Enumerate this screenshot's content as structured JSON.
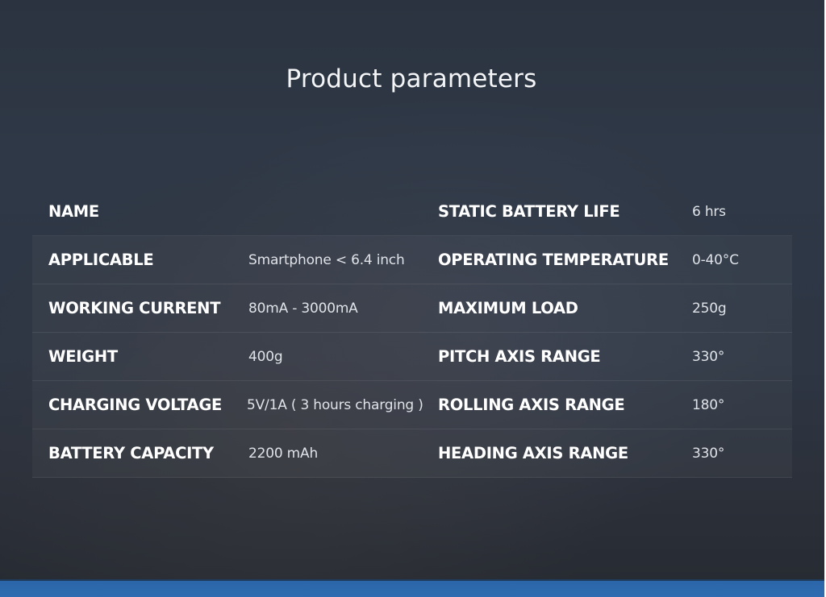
{
  "title": "Product parameters",
  "rows": [
    {
      "label_left": "NAME",
      "value_left": "",
      "label_right": "STATIC BATTERY LIFE",
      "value_right": "6 hrs"
    },
    {
      "label_left": "APPLICABLE",
      "value_left": "Smartphone < 6.4 inch",
      "label_right": "OPERATING TEMPERATURE",
      "value_right": "0-40°C"
    },
    {
      "label_left": "WORKING CURRENT",
      "value_left": "80mA - 3000mA",
      "label_right": "MAXIMUM LOAD",
      "value_right": "250g"
    },
    {
      "label_left": "WEIGHT",
      "value_left": "400g",
      "label_right": "PITCH AXIS RANGE",
      "value_right": "330°"
    },
    {
      "label_left": "CHARGING VOLTAGE",
      "value_left": "5V/1A ( 3 hours charging )",
      "label_right": "ROLLING AXIS RANGE",
      "value_right": "180°"
    },
    {
      "label_left": "BATTERY CAPACITY",
      "value_left": "2200 mAh",
      "label_right": "HEADING AXIS RANGE",
      "value_right": "330°"
    }
  ],
  "colors": {
    "background": "#2e3644",
    "accent_bar": "#2f6bb0",
    "text": "#ffffff"
  }
}
